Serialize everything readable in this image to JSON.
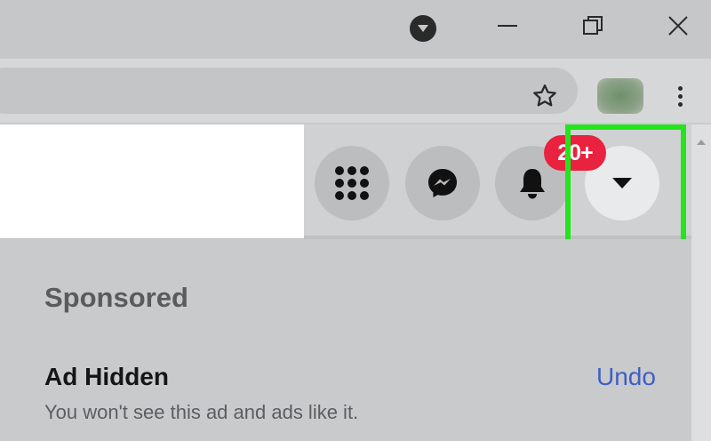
{
  "titlebar": {
    "tab_search_icon": "chevron-down-circle-icon",
    "minimize_icon": "minimize-icon",
    "restore_icon": "restore-icon",
    "close_icon": "close-icon"
  },
  "toolbar": {
    "bookmark_icon": "star-icon",
    "profile_icon": "avatar",
    "menu_icon": "kebab-menu-icon"
  },
  "header": {
    "buttons": [
      {
        "name": "menu",
        "icon": "grid-dots-icon"
      },
      {
        "name": "messenger",
        "icon": "messenger-icon"
      },
      {
        "name": "notifications",
        "icon": "bell-icon"
      },
      {
        "name": "account",
        "icon": "caret-down-icon"
      }
    ],
    "notifications_badge": "20+",
    "highlight_color": "#22e51b",
    "badge_color": "#e8223f"
  },
  "content": {
    "section_title": "Sponsored",
    "ad_title": "Ad Hidden",
    "ad_subtitle": "You won't see this ad and ads like it.",
    "undo_label": "Undo",
    "link_color": "#3f5ec4"
  }
}
